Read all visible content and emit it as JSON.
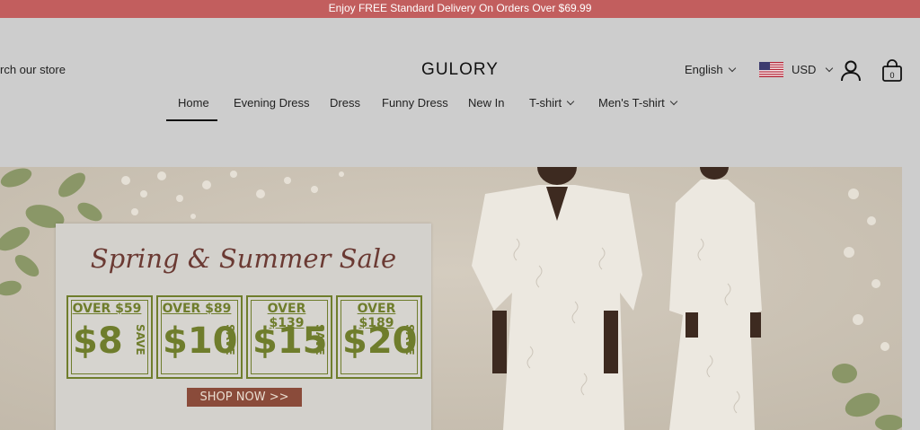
{
  "promo": {
    "text": "Enjoy FREE Standard Delivery On Orders Over $69.99"
  },
  "header": {
    "search_text": "rch our store",
    "brand": "GULORY",
    "language": "English",
    "currency": "USD",
    "cart_count": "0"
  },
  "nav": {
    "items": [
      {
        "label": "Home",
        "active": true
      },
      {
        "label": "Evening Dress"
      },
      {
        "label": "Dress"
      },
      {
        "label": "Funny Dress"
      },
      {
        "label": "New In"
      },
      {
        "label": "T-shirt",
        "has_dropdown": true
      },
      {
        "label": "Men's T-shirt",
        "has_dropdown": true
      }
    ]
  },
  "hero": {
    "title": "Spring & Summer Sale",
    "deals": [
      {
        "threshold": "OVER $59",
        "amount": "$8",
        "save": "SAVE"
      },
      {
        "threshold": "OVER $89",
        "amount": "$10",
        "save": "SAVE"
      },
      {
        "threshold": "OVER $139",
        "amount": "$15",
        "save": "SAVE"
      },
      {
        "threshold": "OVER $189",
        "amount": "$20",
        "save": "SAVE"
      }
    ],
    "cta": "SHOP NOW >>"
  },
  "colors": {
    "promo_bar": "#c25e5e",
    "deal_green": "#6f7d2c",
    "cta_brown": "#8a4b3a"
  }
}
